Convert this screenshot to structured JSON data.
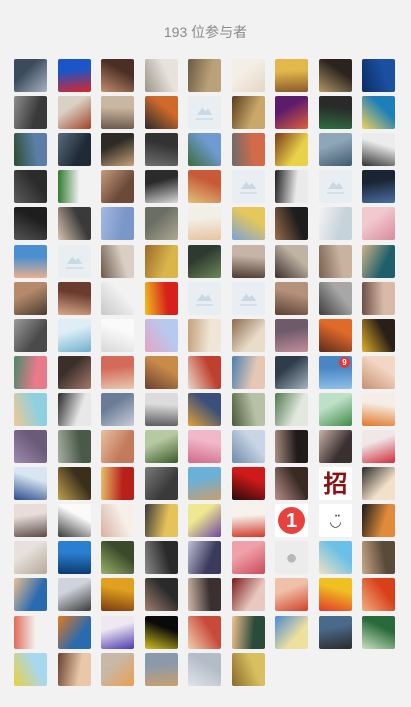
{
  "header": {
    "title": "193 位参与者"
  },
  "avatars": [
    {
      "c": [
        "#3b4a5c",
        "#a7b4c2"
      ]
    },
    {
      "c": [
        "#1c55c8",
        "#d8262a"
      ]
    },
    {
      "c": [
        "#4b2f25",
        "#c28e6f"
      ]
    },
    {
      "c": [
        "#e7e3dc",
        "#9b948a"
      ]
    },
    {
      "c": [
        "#b9a27a",
        "#6b5a43"
      ]
    },
    {
      "c": [
        "#f4efe6",
        "#e3d7c3"
      ]
    },
    {
      "c": [
        "#e3b84a",
        "#8a5a2a"
      ]
    },
    {
      "c": [
        "#2a231e",
        "#b29768"
      ]
    },
    {
      "c": [
        "#1b4fa0",
        "#0b2d63"
      ]
    },
    {
      "c": [
        "#3a3a3a",
        "#8d8d8d"
      ]
    },
    {
      "c": [
        "#d9d1c4",
        "#a04028"
      ]
    },
    {
      "c": [
        "#c9b7a2",
        "#6d5849"
      ]
    },
    {
      "c": [
        "#d06a2b",
        "#2b2b2b"
      ]
    },
    {
      "p": true
    },
    {
      "c": [
        "#caa86b",
        "#5a3d1f"
      ]
    },
    {
      "c": [
        "#5c1b6b",
        "#e2603b"
      ]
    },
    {
      "c": [
        "#2a2a2a",
        "#2e6e3f"
      ]
    },
    {
      "c": [
        "#1d7fb8",
        "#f2d15a"
      ]
    },
    {
      "c": [
        "#5a7ea8",
        "#2f4b2f"
      ]
    },
    {
      "c": [
        "#1f2a36",
        "#5a6b7d"
      ]
    },
    {
      "c": [
        "#2e2a26",
        "#c8a27a"
      ]
    },
    {
      "c": [
        "#333",
        "#6f6f6f"
      ]
    },
    {
      "c": [
        "#6f9bd1",
        "#3d6b3d"
      ]
    },
    {
      "c": [
        "#d36b4a",
        "#6b6b6b"
      ]
    },
    {
      "c": [
        "#e8d24a",
        "#7a3a1a"
      ]
    },
    {
      "c": [
        "#8fa6b8",
        "#3f5a6f"
      ]
    },
    {
      "c": [
        "#ececec",
        "#333"
      ]
    },
    {
      "c": [
        "#2b2b2b",
        "#5c5c5c"
      ]
    },
    {
      "c": [
        "#f2f2f2",
        "#2f7a2f"
      ]
    },
    {
      "c": [
        "#6b4a3a",
        "#c69a7b"
      ]
    },
    {
      "c": [
        "#2b2b2b",
        "#d9d9d9"
      ]
    },
    {
      "c": [
        "#c85a3a",
        "#e0c07a"
      ]
    },
    {
      "p": true
    },
    {
      "c": [
        "#eaeaea",
        "#1f1f1f"
      ]
    },
    {
      "p": true
    },
    {
      "c": [
        "#1a2533",
        "#4a6fa3"
      ]
    },
    {
      "c": [
        "#1e1e1e",
        "#555"
      ]
    },
    {
      "c": [
        "#3a3a3a",
        "#d9c3b0"
      ]
    },
    {
      "c": [
        "#7b96c9",
        "#a5b9e0"
      ]
    },
    {
      "c": [
        "#6b6e63",
        "#adaa93"
      ]
    },
    {
      "c": [
        "#f2efe6",
        "#e8c4a0"
      ]
    },
    {
      "c": [
        "#e6c75a",
        "#7aa3d6"
      ]
    },
    {
      "c": [
        "#1d1d1d",
        "#9b6b4a"
      ]
    },
    {
      "c": [
        "#c7d3db",
        "#f4f4f4"
      ]
    },
    {
      "c": [
        "#f2c9cf",
        "#d98a9b"
      ]
    },
    {
      "c": [
        "#4a8fd0",
        "#e8b090"
      ]
    },
    {
      "p": true
    },
    {
      "c": [
        "#d9cfc4",
        "#6b5a4a"
      ]
    },
    {
      "c": [
        "#d9b54a",
        "#9a6b2a"
      ]
    },
    {
      "c": [
        "#2f3a2f",
        "#6b8a5a"
      ]
    },
    {
      "c": [
        "#c7b4a8",
        "#4a3a30"
      ]
    },
    {
      "c": [
        "#bfb3a4",
        "#3a302a"
      ]
    },
    {
      "c": [
        "#c9b3a0",
        "#7a6050"
      ]
    },
    {
      "c": [
        "#1f5f6a",
        "#d0b28a"
      ]
    },
    {
      "c": [
        "#b48a6b",
        "#4a3a2f"
      ]
    },
    {
      "c": [
        "#6b3b2f",
        "#d8a88a"
      ]
    },
    {
      "c": [
        "#f2f2f2",
        "#c8c8c8"
      ]
    },
    {
      "c": [
        "#d8201a",
        "#f0c020"
      ]
    },
    {
      "p": true
    },
    {
      "p": true
    },
    {
      "c": [
        "#b3917a",
        "#5a4033"
      ]
    },
    {
      "c": [
        "#a7a7a7",
        "#3d3d3d"
      ]
    },
    {
      "c": [
        "#d9b9a8",
        "#6b4f45"
      ]
    },
    {
      "c": [
        "#4a4a4a",
        "#9a9a9a"
      ]
    },
    {
      "c": [
        "#dfeef5",
        "#6fb0d0"
      ]
    },
    {
      "c": [
        "#fafafa",
        "#d8d8d8"
      ]
    },
    {
      "c": [
        "#b8c9f0",
        "#e5a3c3"
      ]
    },
    {
      "c": [
        "#f1e5d6",
        "#c2a07a"
      ]
    },
    {
      "c": [
        "#e9dcc8",
        "#8a6b4f"
      ]
    },
    {
      "c": [
        "#6d5a6b",
        "#c38f9b"
      ]
    },
    {
      "c": [
        "#e06a2a",
        "#5a2a1a"
      ]
    },
    {
      "c": [
        "#2a1f18",
        "#e0b02a"
      ]
    },
    {
      "c": [
        "#e87a8a",
        "#4a8a6a"
      ]
    },
    {
      "c": [
        "#3a2f2a",
        "#a37a6a"
      ]
    },
    {
      "c": [
        "#d46a5a",
        "#e9c8b0"
      ]
    },
    {
      "c": [
        "#c88b4a",
        "#6b3f2f"
      ]
    },
    {
      "c": [
        "#c04030",
        "#e8d8c8"
      ]
    },
    {
      "c": [
        "#e6c7b6",
        "#4a7fb0"
      ]
    },
    {
      "c": [
        "#2f3c4a",
        "#a6b4c0"
      ]
    },
    {
      "c": [
        "#4a86c4",
        "#8fc0e8"
      ],
      "badge": "9"
    },
    {
      "c": [
        "#f3d6c4",
        "#c79070"
      ]
    },
    {
      "c": [
        "#8fd0e0",
        "#f0c890"
      ]
    },
    {
      "c": [
        "#e8e8e8",
        "#2a2a2a"
      ]
    },
    {
      "c": [
        "#6b7d96",
        "#c9ced8"
      ]
    },
    {
      "c": [
        "#dcdcdc",
        "#5a5a5a"
      ]
    },
    {
      "c": [
        "#3a4f7a",
        "#e0a03a"
      ]
    },
    {
      "c": [
        "#b7c1a6",
        "#4a5a3a"
      ]
    },
    {
      "c": [
        "#e3e8df",
        "#4f7a4f"
      ]
    },
    {
      "c": [
        "#bfe0c8",
        "#3f8a4a"
      ]
    },
    {
      "c": [
        "#f6ede6",
        "#e07a2a"
      ]
    },
    {
      "c": [
        "#6b5a78",
        "#a08ab0"
      ]
    },
    {
      "c": [
        "#4a5a4a",
        "#a8b0a0"
      ]
    },
    {
      "c": [
        "#c27a5a",
        "#e8c0a0"
      ]
    },
    {
      "c": [
        "#b7c9a0",
        "#3a5a2a"
      ]
    },
    {
      "c": [
        "#f0b8c8",
        "#d06a8a"
      ]
    },
    {
      "c": [
        "#c9d5e6",
        "#6f8aa8"
      ]
    },
    {
      "c": [
        "#201a18",
        "#a88e80"
      ]
    },
    {
      "c": [
        "#3a3030",
        "#c8b0a8"
      ]
    },
    {
      "c": [
        "#f0e8e8",
        "#d02a3a"
      ]
    },
    {
      "c": [
        "#d8e6f2",
        "#2a4a8a"
      ]
    },
    {
      "c": [
        "#3a2f1a",
        "#c0a050"
      ]
    },
    {
      "c": [
        "#b8201a",
        "#e8c06a"
      ]
    },
    {
      "c": [
        "#3a3a3a",
        "#7a7a7a"
      ]
    },
    {
      "c": [
        "#6ab0d8",
        "#c8a06a"
      ]
    },
    {
      "c": [
        "#d01a1a",
        "#2a0a0a"
      ]
    },
    {
      "c": [
        "#3a2a24",
        "#b8908a"
      ]
    },
    {
      "t": "zhao",
      "big": "招",
      "c": [
        "#ffffff",
        "#ffffff"
      ]
    },
    {
      "c": [
        "#f2e0c8",
        "#2a2a2a"
      ]
    },
    {
      "c": [
        "#e8ddd8",
        "#5a4a48"
      ]
    },
    {
      "c": [
        "#fafafa",
        "#3a3a3a"
      ]
    },
    {
      "c": [
        "#f7efe8",
        "#d8b0a0"
      ]
    },
    {
      "c": [
        "#e6c25a",
        "#3a3a3a"
      ]
    },
    {
      "c": [
        "#f0e890",
        "#6a4aa0"
      ]
    },
    {
      "c": [
        "#f7f2ec",
        "#d23a2a"
      ]
    },
    {
      "t": "red-circle",
      "big": "1",
      "c": [
        "#ffffff",
        "#ffffff"
      ]
    },
    {
      "t": "smile",
      "big": "◡̈",
      "c": [
        "#ffffff",
        "#ffffff"
      ]
    },
    {
      "c": [
        "#e08a3a",
        "#1a1a1a"
      ]
    },
    {
      "c": [
        "#e6e1dc",
        "#b5a898"
      ]
    },
    {
      "c": [
        "#2a7fd0",
        "#0a3a70"
      ]
    },
    {
      "c": [
        "#3a4a2a",
        "#9ab06a"
      ]
    },
    {
      "c": [
        "#2a2a2a",
        "#8a8a8a"
      ]
    },
    {
      "c": [
        "#3a3a5a",
        "#c0c0d8"
      ]
    },
    {
      "c": [
        "#f0a0a8",
        "#c84a5a"
      ]
    },
    {
      "t": "person",
      "big": "●",
      "c": [
        "#ececec",
        "#ececec"
      ]
    },
    {
      "c": [
        "#6ac0e8",
        "#f0e0c0"
      ]
    },
    {
      "c": [
        "#5a4a3a",
        "#c8a888"
      ]
    },
    {
      "c": [
        "#2a6ab0",
        "#e8c090"
      ]
    },
    {
      "c": [
        "#cfd4dc",
        "#3a3a3a"
      ]
    },
    {
      "c": [
        "#e0a020",
        "#7a3a10"
      ]
    },
    {
      "c": [
        "#2a2a2a",
        "#a08070"
      ]
    },
    {
      "c": [
        "#3a3030",
        "#d0b8a8"
      ]
    },
    {
      "c": [
        "#e8c8c0",
        "#7a1a1a"
      ]
    },
    {
      "c": [
        "#f0c0a8",
        "#d0402a"
      ]
    },
    {
      "c": [
        "#f0c020",
        "#e03a2a"
      ]
    },
    {
      "c": [
        "#d8401a",
        "#f0b080"
      ]
    },
    {
      "c": [
        "#f4f2f0",
        "#e06a5a"
      ]
    },
    {
      "c": [
        "#2a6ab0",
        "#e07a20"
      ]
    },
    {
      "c": [
        "#f0e8f0",
        "#4a3ab0"
      ]
    },
    {
      "c": [
        "#0a0a0a",
        "#d0c020"
      ]
    },
    {
      "c": [
        "#c84a3a",
        "#f0d0b0"
      ]
    },
    {
      "c": [
        "#2a4a3a",
        "#f0c090"
      ]
    },
    {
      "c": [
        "#f0e0a0",
        "#4a8ad0"
      ]
    },
    {
      "c": [
        "#4a6a8a",
        "#2a2a2a"
      ]
    },
    {
      "c": [
        "#2a6a3a",
        "#c8e0c0"
      ]
    },
    {
      "c": [
        "#a8d8f0",
        "#e8d040"
      ]
    },
    {
      "c": [
        "#e8c8a8",
        "#6a4030"
      ]
    },
    {
      "c": [
        "#c8b8a8",
        "#e8a050"
      ]
    },
    {
      "c": [
        "#8a9aaa",
        "#c8a070"
      ]
    },
    {
      "c": [
        "#b4bcc8",
        "#e0e4ea"
      ]
    },
    {
      "c": [
        "#d8c060",
        "#8a6a2a"
      ]
    }
  ],
  "colors": {
    "background": "#f2f2f2",
    "header_text": "#8a8a8a",
    "badge": "#e53935"
  }
}
